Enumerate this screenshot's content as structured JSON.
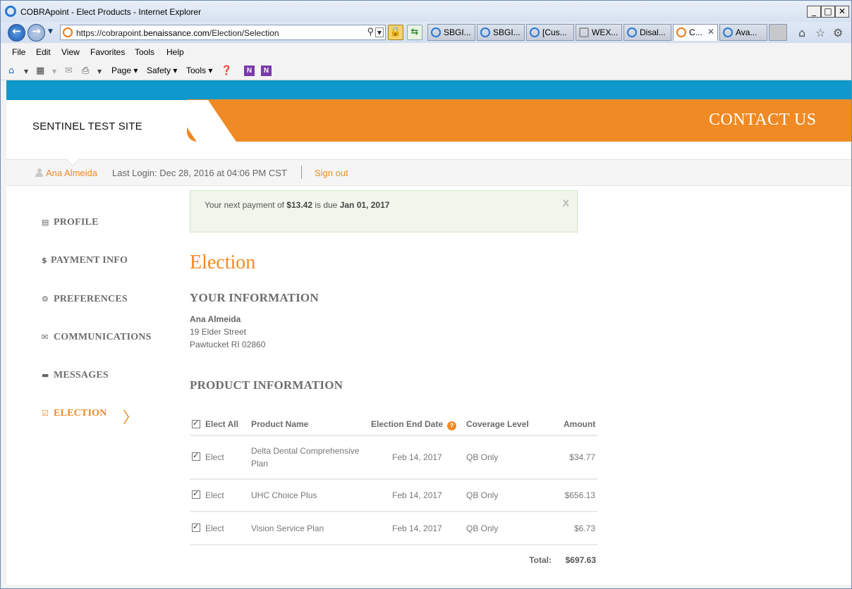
{
  "browser": {
    "window_title": "COBRApoint - Elect Products - Internet Explorer",
    "url_prefix": "https://cobrapoint.",
    "url_host": "benaissance.com",
    "url_path": "/Election/Selection",
    "tabs": [
      {
        "label": "SBGI..."
      },
      {
        "label": "SBGI..."
      },
      {
        "label": "[Cus..."
      },
      {
        "label": "WEX..."
      },
      {
        "label": "Disal..."
      },
      {
        "label": "C..."
      },
      {
        "label": "Ava..."
      }
    ],
    "menu": [
      "File",
      "Edit",
      "View",
      "Favorites",
      "Tools",
      "Help"
    ],
    "command_bar": {
      "page": "Page",
      "safety": "Safety",
      "tools": "Tools"
    }
  },
  "header": {
    "site_name": "SENTINEL TEST SITE",
    "contact": "CONTACT US",
    "accent_color": "#f08a24",
    "stripe_color": "#0f98cc"
  },
  "userbar": {
    "user_name": "Ana Almeida",
    "last_login": "Last Login: Dec 28, 2016 at 04:06 PM CST",
    "sign_out": "Sign out"
  },
  "alert": {
    "prefix": "Your next payment of ",
    "amount": "$13.42",
    "middle": " is due ",
    "date": "Jan 01, 2017",
    "close": "X"
  },
  "sidebar": {
    "items": [
      {
        "label": "PROFILE",
        "icon": "id-card-icon"
      },
      {
        "label": "PAYMENT INFO",
        "icon": "dollar-icon"
      },
      {
        "label": "PREFERENCES",
        "icon": "gears-icon"
      },
      {
        "label": "COMMUNICATIONS",
        "icon": "envelope-icon"
      },
      {
        "label": "MESSAGES",
        "icon": "speech-bubble-icon"
      },
      {
        "label": "ELECTION",
        "icon": "checkbox-icon",
        "active": true
      }
    ]
  },
  "main": {
    "title": "Election",
    "your_info": {
      "heading": "YOUR INFORMATION",
      "name": "Ana Almeida",
      "street": "19 Elder Street",
      "city": "Pawtucket RI 02860"
    },
    "product_info": {
      "heading": "PRODUCT INFORMATION",
      "columns": {
        "elect_all": "Elect All",
        "product_name": "Product Name",
        "end_date": "Election End Date",
        "coverage": "Coverage Level",
        "amount": "Amount"
      },
      "rows": [
        {
          "elect": "Elect",
          "checked": true,
          "product": "Delta Dental Comprehensive Plan",
          "end_date": "Feb 14, 2017",
          "coverage": "QB Only",
          "amount": "$34.77"
        },
        {
          "elect": "Elect",
          "checked": true,
          "product": "UHC Choice Plus",
          "end_date": "Feb 14, 2017",
          "coverage": "QB Only",
          "amount": "$656.13"
        },
        {
          "elect": "Elect",
          "checked": true,
          "product": "Vision Service Plan",
          "end_date": "Feb 14, 2017",
          "coverage": "QB Only",
          "amount": "$6.73"
        }
      ],
      "total_label": "Total:",
      "total_value": "$697.63"
    }
  }
}
